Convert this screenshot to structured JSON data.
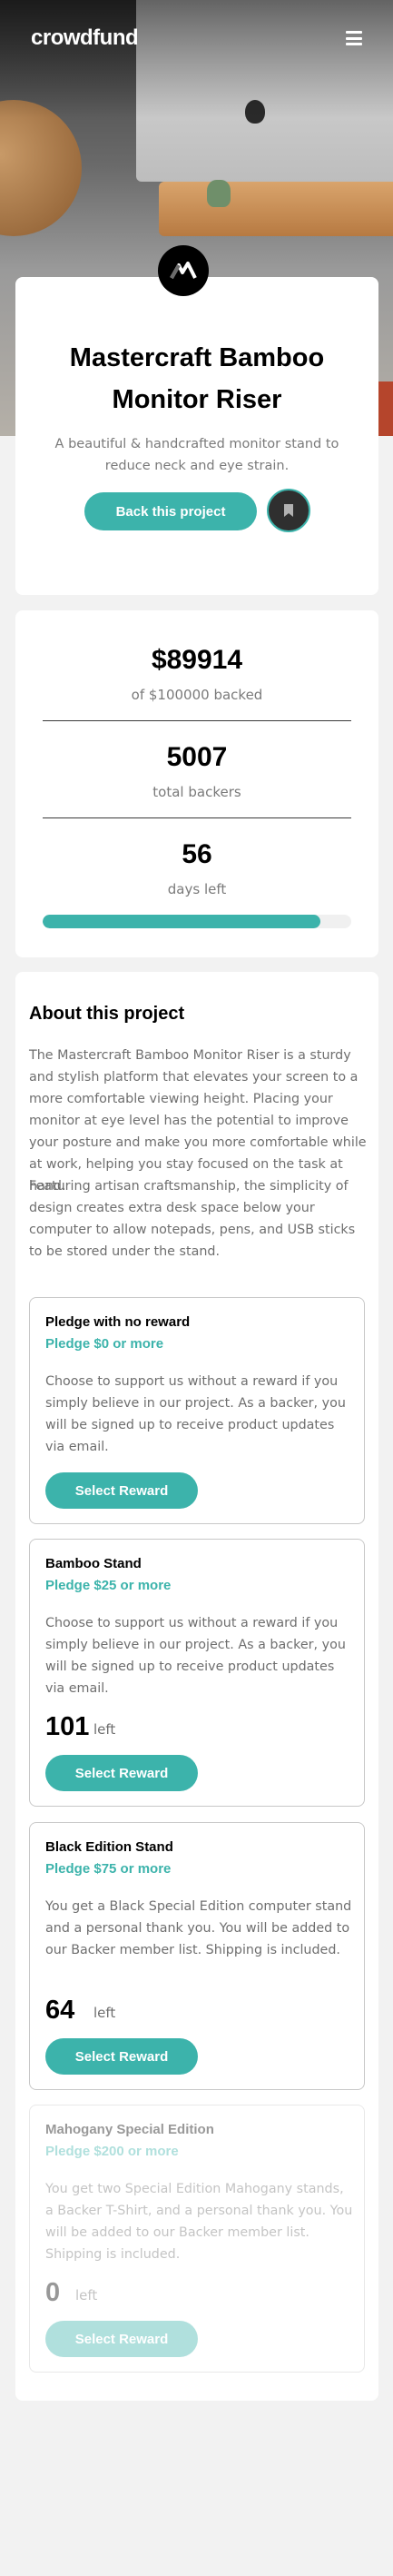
{
  "header": {
    "logo": "crowdfund",
    "menu_icon": "hamburger-icon"
  },
  "intro": {
    "logo_icon": "mastercraft-logo-icon",
    "title": "Mastercraft Bamboo Monitor Riser",
    "description": "A beautiful & handcrafted monitor stand to reduce neck and eye strain.",
    "back_button": "Back this project",
    "bookmark_icon": "bookmark-icon"
  },
  "stats": {
    "amount": "$89914",
    "amount_label": "of $100000 backed",
    "backers": "5007",
    "backers_label": "total backers",
    "days": "56",
    "days_label": "days left",
    "progress_fraction": 0.899
  },
  "about": {
    "title": "About this project",
    "paragraphs": [
      "The Mastercraft Bamboo Monitor Riser is a sturdy and stylish platform that elevates your screen to a more comfortable viewing height. Placing your monitor at eye level has the potential to improve your posture and make you more comfortable while at work, helping you stay focused on the task at hand.",
      "Featuring artisan craftsmanship, the simplicity of design creates extra desk space below your computer to allow notepads, pens, and USB sticks to be stored under the stand."
    ]
  },
  "rewards": [
    {
      "name": "Pledge with no reward",
      "pledge": "Pledge $0 or more",
      "description": "Choose to support us without a reward if you simply believe in our project. As a backer, you will be signed up to receive product updates via email.",
      "left": "",
      "left_label": "",
      "button": "Select Reward"
    },
    {
      "name": "Bamboo Stand",
      "pledge": "Pledge $25 or more",
      "description": "Choose to support us without a reward if you simply believe in our project. As a backer, you will be signed up to receive product updates via email.",
      "left": "101",
      "left_label": "left",
      "button": "Select Reward"
    },
    {
      "name": "Black Edition Stand",
      "pledge": "Pledge $75 or more",
      "description": "You get a Black Special Edition computer stand and a personal thank you. You will be added to our Backer member list. Shipping is included.",
      "left": "64",
      "left_label": "left",
      "button": "Select Reward"
    },
    {
      "name": "Mahogany Special Edition",
      "pledge": "Pledge $200 or more",
      "description": "You get two Special Edition Mahogany stands, a Backer T-Shirt, and a personal thank you. You will be added to our Backer member list. Shipping is included.",
      "left": "0",
      "left_label": "left",
      "button": "Select Reward"
    }
  ],
  "colors": {
    "accent": "#3cb3ab",
    "dark": "#2f2f2f",
    "text_muted": "#7a7a7a"
  }
}
